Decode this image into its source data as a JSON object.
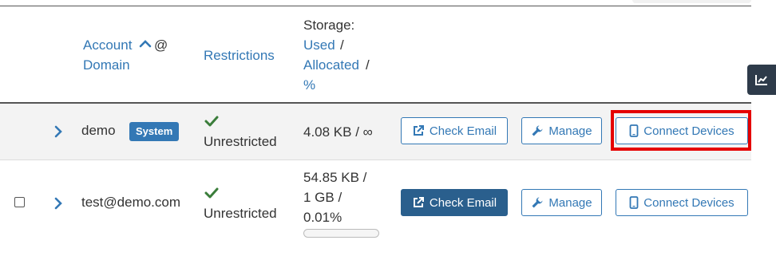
{
  "header": {
    "account_label": "Account",
    "at_label": "@",
    "domain_label": "Domain",
    "restrictions_label": "Restrictions",
    "storage_label": "Storage:",
    "used_label": "Used",
    "slash1": "/",
    "allocated_label": "Allocated",
    "slash2": "/",
    "percent_label": "%"
  },
  "rows": [
    {
      "account": "demo",
      "badge": "System",
      "restriction": "Unrestricted",
      "storage": "4.08 KB / ∞",
      "buttons": {
        "check_email": "Check Email",
        "manage": "Manage",
        "connect": "Connect Devices"
      }
    },
    {
      "account": "test@demo.com",
      "restriction": "Unrestricted",
      "storage_used": "54.85 KB /",
      "storage_alloc": "1 GB /",
      "storage_pct": "0.01%",
      "storage_fraction": 0.0001,
      "buttons": {
        "check_email": "Check Email",
        "manage": "Manage",
        "connect": "Connect Devices"
      }
    }
  ],
  "colors": {
    "link": "#3378b5",
    "primary_button": "#2a5f8d",
    "check": "#3a7d3a",
    "highlight": "#e50000",
    "side_button": "#2e3b4a"
  },
  "icons": {
    "sort": "chevron-up-icon",
    "expand": "chevron-right-icon",
    "status": "check-icon",
    "check_email": "external-link-icon",
    "manage": "wrench-icon",
    "connect": "mobile-device-icon",
    "side": "line-chart-icon"
  }
}
